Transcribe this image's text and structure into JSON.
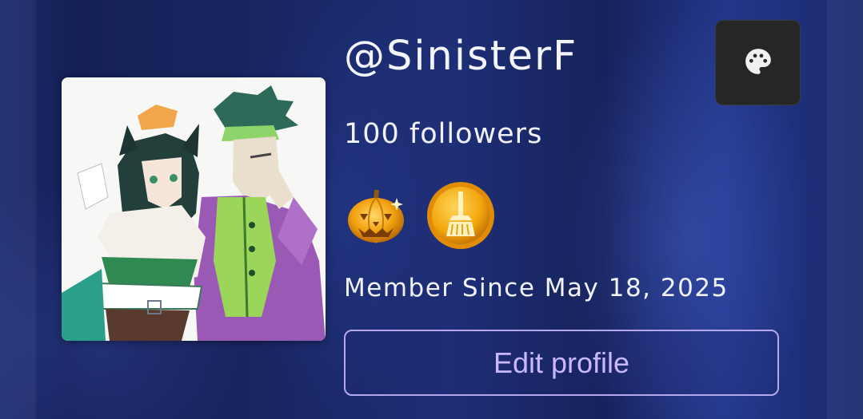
{
  "profile": {
    "username": "@SinisterF",
    "followers_text": "100 followers",
    "member_since_text": "Member Since May 18, 2025",
    "edit_button_label": "Edit profile",
    "avatar": "anime-characters-avatar"
  },
  "badges": [
    {
      "icon": "jack-o-lantern-badge-icon"
    },
    {
      "icon": "broom-coin-badge-icon"
    }
  ],
  "actions": {
    "theme_button_icon": "palette-icon"
  },
  "colors": {
    "background": "#1a2a6e",
    "button_border": "#b7a8ee",
    "button_text": "#c9b7ff",
    "theme_button": "#262626",
    "badge_gold": "#f2a60d"
  }
}
